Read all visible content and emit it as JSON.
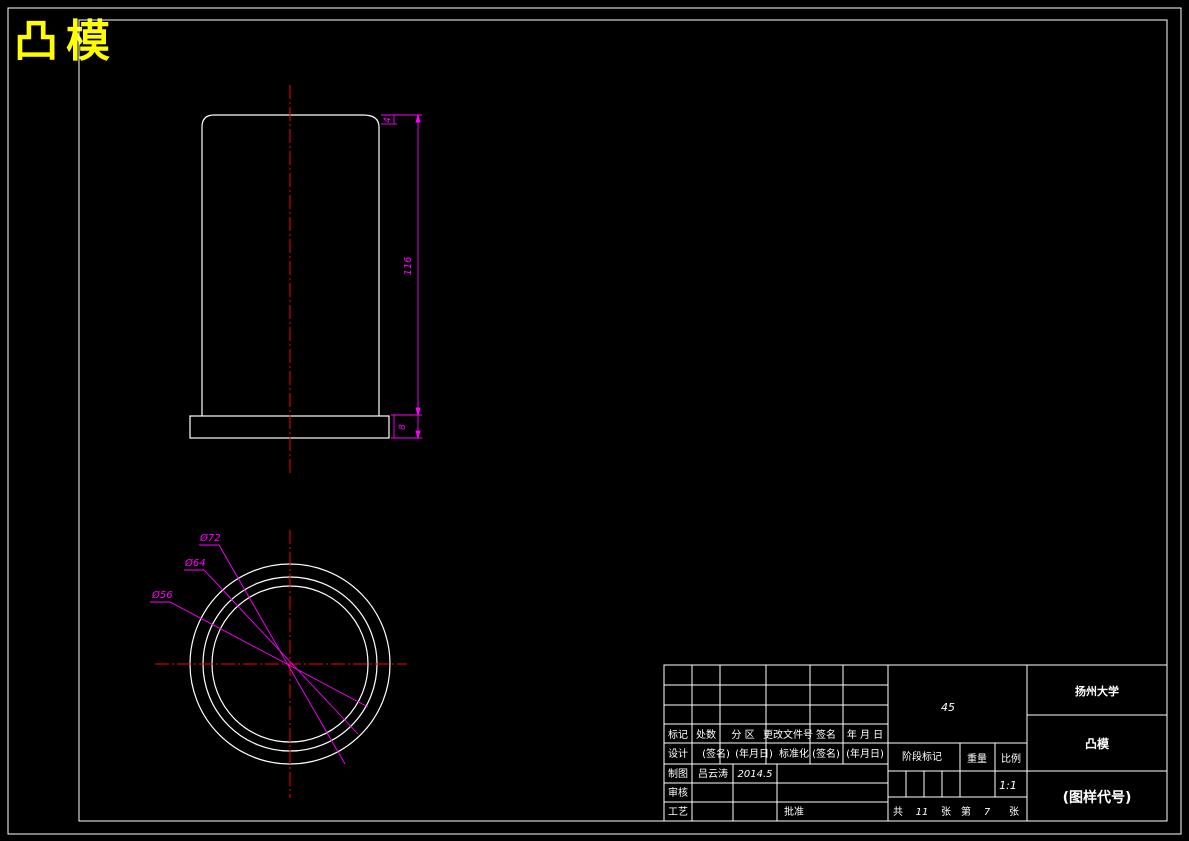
{
  "drawing": {
    "title": "凸模",
    "colors": {
      "background": "#000000",
      "outline": "#ffffff",
      "centerline": "#ff0000",
      "dimension": "#ff00ff",
      "title": "#ffff00"
    },
    "dimensions": {
      "top_offset": "4",
      "height": "116",
      "flange": "8",
      "dia_outer": "Ø72",
      "dia_mid": "Ø64",
      "dia_inner": "Ø56"
    }
  },
  "title_block": {
    "material": "45",
    "school": "扬州大学",
    "part_name": "凸模",
    "drawing_code": "(图样代号)",
    "headers": {
      "mark": "标记",
      "count": "处数",
      "zone": "分 区",
      "change_doc": "更改文件号",
      "signature": "签名",
      "date": "年 月 日"
    },
    "rows": {
      "design": "设计",
      "design_sig": "(签名)",
      "design_date": "(年月日)",
      "standardize": "标准化",
      "std_sig": "(签名)",
      "std_date": "(年月日)",
      "draw": "制图",
      "drawer": "吕云涛",
      "draw_date": "2014.5",
      "review": "审核",
      "process": "工艺",
      "approve": "批准"
    },
    "stage_mark": "阶段标记",
    "weight": "重量",
    "scale_label": "比例",
    "scale": "1:1",
    "total_label": "共",
    "total": "11",
    "sheet_label": "张",
    "page_label": "第",
    "page": "7",
    "page_unit": "张"
  }
}
